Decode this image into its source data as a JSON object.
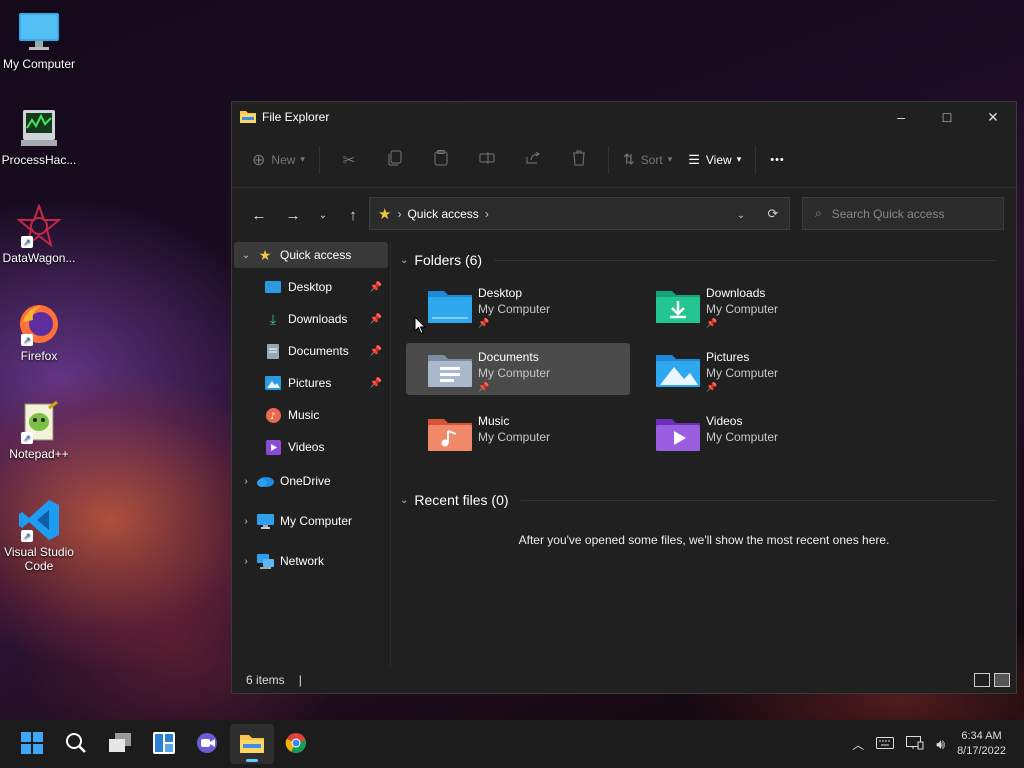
{
  "desktop": {
    "icons": [
      {
        "label": "My Computer"
      },
      {
        "label": "ProcessHac..."
      },
      {
        "label": "DataWagon..."
      },
      {
        "label": "Firefox"
      },
      {
        "label": "Notepad++"
      },
      {
        "label": "Visual Studio Code"
      }
    ]
  },
  "window": {
    "title": "File Explorer",
    "controls": {
      "minimize": "–",
      "maximize": "□",
      "close": "✕"
    }
  },
  "toolbar": {
    "new_label": "New",
    "sort_label": "Sort",
    "view_label": "View",
    "more_label": "•••"
  },
  "address": {
    "location": "Quick access",
    "search_placeholder": "Search Quick access"
  },
  "sidebar": {
    "quick_access": "Quick access",
    "items": [
      {
        "label": "Desktop",
        "pinned": true
      },
      {
        "label": "Downloads",
        "pinned": true
      },
      {
        "label": "Documents",
        "pinned": true
      },
      {
        "label": "Pictures",
        "pinned": true
      },
      {
        "label": "Music",
        "pinned": false
      },
      {
        "label": "Videos",
        "pinned": false
      }
    ],
    "onedrive": "OneDrive",
    "my_computer": "My Computer",
    "network": "Network"
  },
  "main": {
    "folders_header": "Folders (6)",
    "folders": [
      {
        "name": "Desktop",
        "location": "My Computer",
        "pinned": true
      },
      {
        "name": "Downloads",
        "location": "My Computer",
        "pinned": true
      },
      {
        "name": "Documents",
        "location": "My Computer",
        "pinned": true
      },
      {
        "name": "Pictures",
        "location": "My Computer",
        "pinned": true
      },
      {
        "name": "Music",
        "location": "My Computer",
        "pinned": false
      },
      {
        "name": "Videos",
        "location": "My Computer",
        "pinned": false
      }
    ],
    "recent_header": "Recent files (0)",
    "recent_empty": "After you've opened some files, we'll show the most recent ones here."
  },
  "status": {
    "items": "6 items",
    "divider": "|"
  },
  "taskbar": {
    "time": "6:34 AM",
    "date": "8/17/2022"
  },
  "colors": {
    "accent": "#60cdff",
    "window_bg": "#202020",
    "selected": "#4a4a4a"
  }
}
